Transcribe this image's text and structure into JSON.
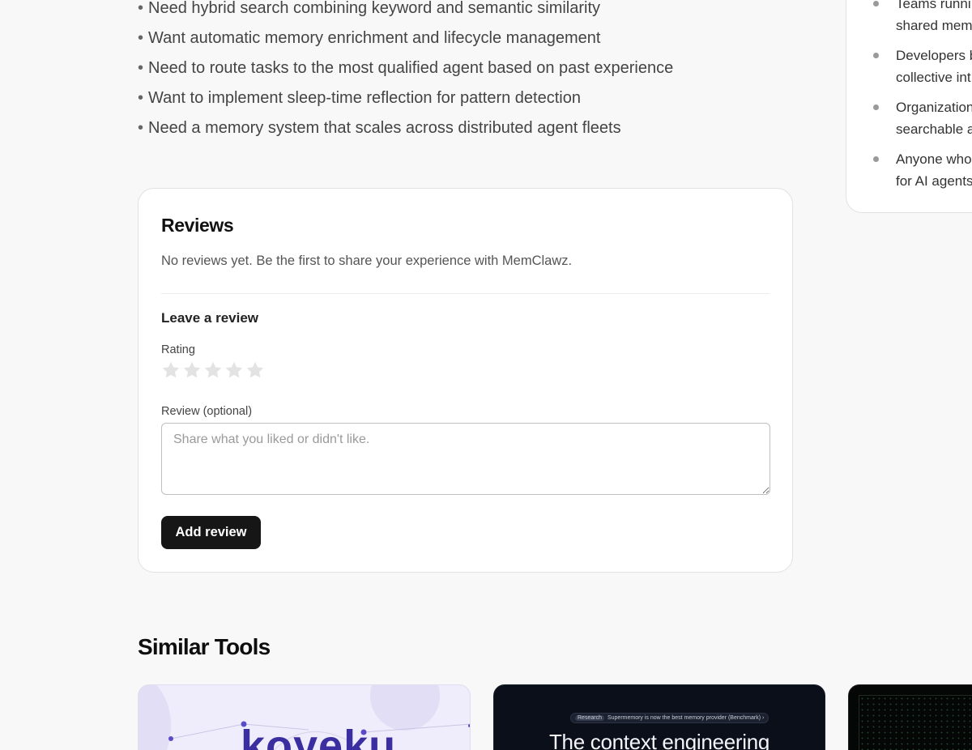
{
  "use_cases": [
    "Need hybrid search combining keyword and semantic similarity",
    "Want automatic memory enrichment and lifecycle management",
    "Need to route tasks to the most qualified agent based on past experience",
    "Want to implement sleep-time reflection for pattern detection",
    "Need a memory system that scales across distributed agent fleets"
  ],
  "bullet_glyph": "•",
  "audience": [
    {
      "line1": "Teams runni",
      "line2": "shared memo"
    },
    {
      "line1": "Developers b",
      "line2": "collective int"
    },
    {
      "line1": "Organization",
      "line2": "searchable a"
    },
    {
      "line1": "Anyone who",
      "line2": "for AI agents"
    }
  ],
  "reviews": {
    "title": "Reviews",
    "empty_message": "No reviews yet. Be the first to share your experience with MemClawz.",
    "form": {
      "title": "Leave a review",
      "rating_label": "Rating",
      "rating_value": 0,
      "rating_max": 5,
      "review_label": "Review (optional)",
      "review_placeholder": "Share what you liked or didn't like.",
      "review_value": "",
      "submit_label": "Add review"
    }
  },
  "similar_tools": {
    "title": "Similar Tools",
    "cards": [
      {
        "logo_text": "koyeku"
      },
      {
        "badge_tag": "Research",
        "badge_text": "Supermemory is now the best memory provider (Benchmark)",
        "badge_arrow": "›",
        "headline": "The context engineering"
      },
      {}
    ]
  },
  "colors": {
    "page_bg": "#f8f8f8",
    "card_bg": "#ffffff",
    "button_bg": "#161616",
    "star_empty": "#e3e3e3"
  }
}
